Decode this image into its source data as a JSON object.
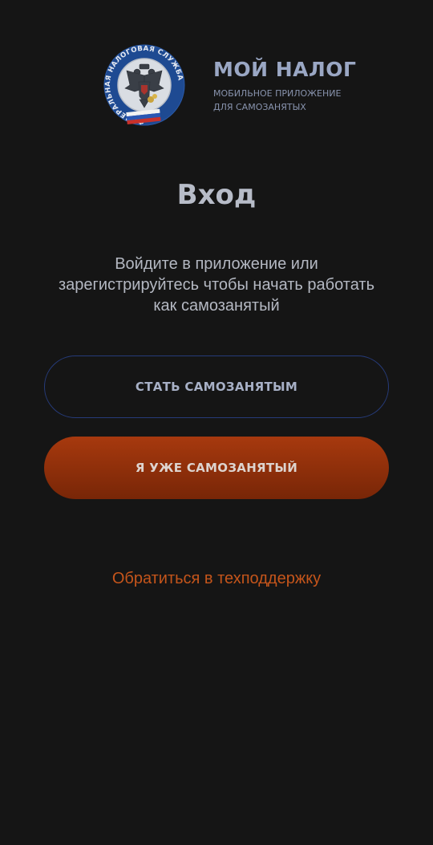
{
  "header": {
    "emblem_text": "ФЕДЕРАЛЬНАЯ НАЛОГОВАЯ СЛУЖБА",
    "app_name": "МОЙ НАЛОГ",
    "subtitle_line1": "МОБИЛЬНОЕ ПРИЛОЖЕНИЕ",
    "subtitle_line2": "ДЛЯ САМОЗАНЯТЫХ"
  },
  "main": {
    "title": "Вход",
    "description_line1": "Войдите в приложение или",
    "description_line2": "зарегистрируйтесь чтобы начать работать",
    "description_line3": "как самозанятый",
    "register_button": "СТАТЬ САМОЗАНЯТЫМ",
    "login_button": "Я УЖЕ САМОЗАНЯТЫЙ",
    "support_link": "Обратиться в техподдержку"
  },
  "colors": {
    "background": "#151515",
    "accent": "#c5551b",
    "outline_border": "#263b7a",
    "brand_text": "#9aa7c4"
  },
  "icons": {
    "emblem": "fns-emblem-icon"
  }
}
